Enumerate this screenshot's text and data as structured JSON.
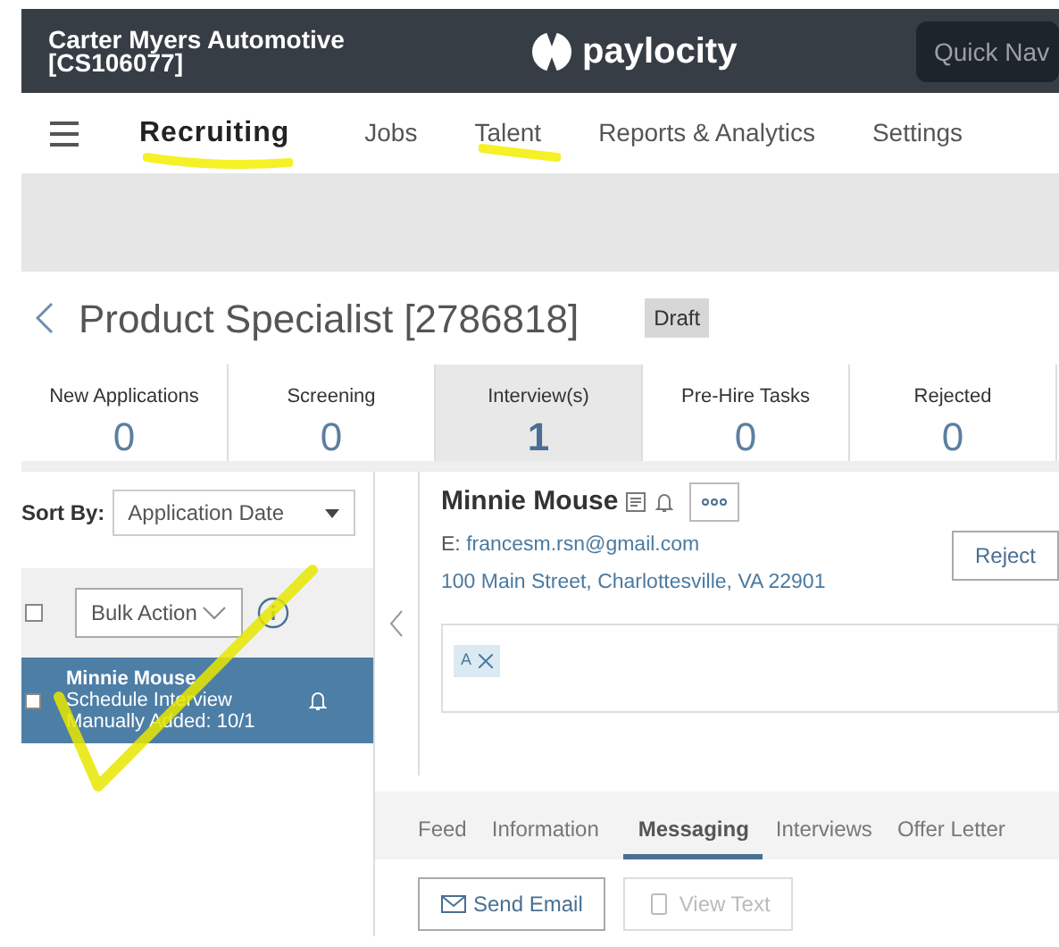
{
  "header": {
    "company": "Carter Myers Automotive",
    "code": "[CS106077]",
    "logo": "paylocity",
    "quick_nav_placeholder": "Quick Nav"
  },
  "nav": [
    {
      "label": "Recruiting",
      "selected": true
    },
    {
      "label": "Jobs",
      "selected": false
    },
    {
      "label": "Talent",
      "selected": false
    },
    {
      "label": "Reports & Analytics",
      "selected": false
    },
    {
      "label": "Settings",
      "selected": false
    }
  ],
  "job": {
    "title": "Product Specialist [2786818]",
    "status": "Draft"
  },
  "stages": [
    {
      "label": "New Applications",
      "count": "0",
      "selected": false
    },
    {
      "label": "Screening",
      "count": "0",
      "selected": false
    },
    {
      "label": "Interview(s)",
      "count": "1",
      "selected": true
    },
    {
      "label": "Pre-Hire Tasks",
      "count": "0",
      "selected": false
    },
    {
      "label": "Rejected",
      "count": "0",
      "selected": false
    }
  ],
  "sort": {
    "label": "Sort By:",
    "value": "Application Date"
  },
  "bulk_action": "Bulk Action",
  "select_all": {
    "checked": false
  },
  "candidates": [
    {
      "name": "Minnie Mouse",
      "status": "Schedule Interview",
      "note": "Manually Added: 10/1",
      "selected": true,
      "checked": false
    }
  ],
  "candidate": {
    "name": "Minnie Mouse",
    "email_label": "E:",
    "email": "francesm.rsn@gmail.com",
    "address": "100 Main Street, Charlottesville, VA 22901",
    "reject": "Reject",
    "tags": [
      {
        "label": "A"
      }
    ]
  },
  "detail_tabs": [
    {
      "label": "Feed",
      "selected": false
    },
    {
      "label": "Information",
      "selected": false
    },
    {
      "label": "Messaging",
      "selected": true
    },
    {
      "label": "Interviews",
      "selected": false
    },
    {
      "label": "Offer Letter",
      "selected": false
    }
  ],
  "actions": [
    {
      "kind": "email",
      "label": "Send Email",
      "disabled": false
    },
    {
      "kind": "phone",
      "label": "View Text",
      "disabled": true
    }
  ]
}
